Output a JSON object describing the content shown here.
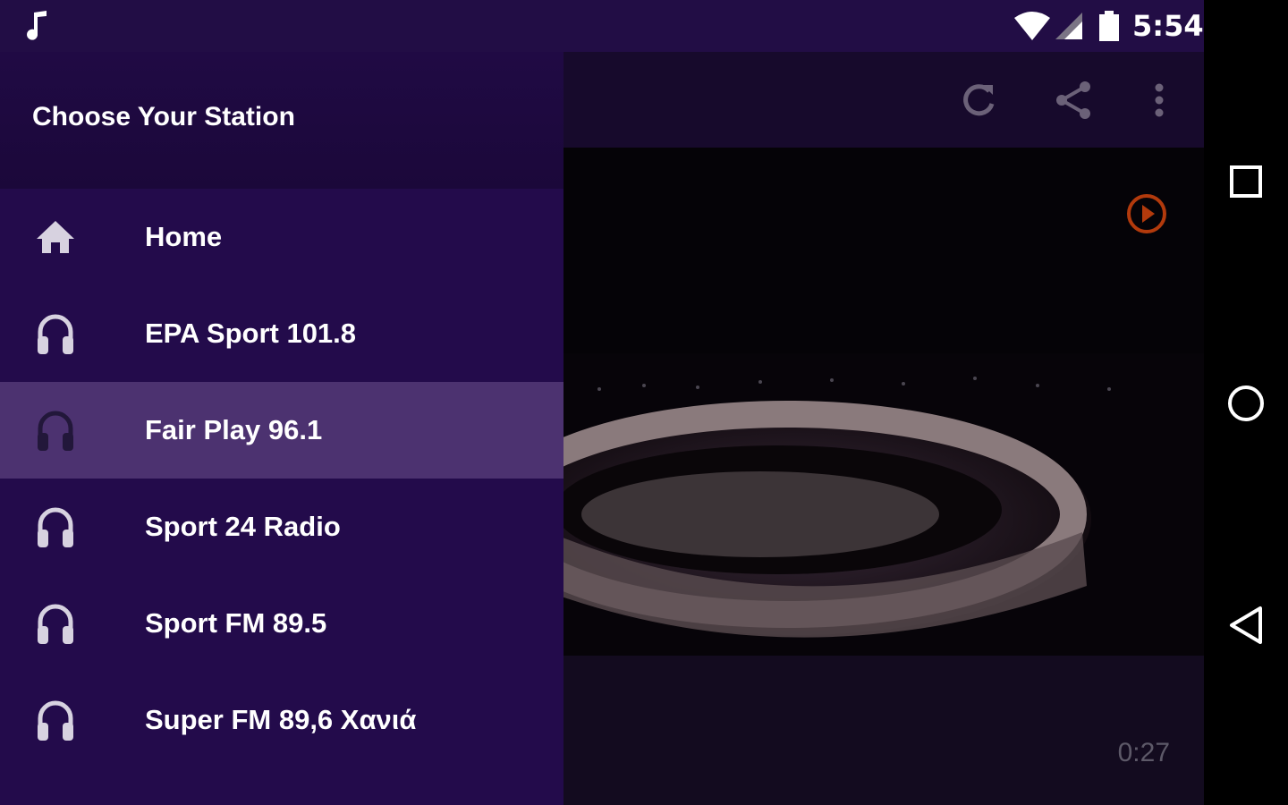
{
  "status_bar": {
    "time": "5:54",
    "icons": [
      "music-note-icon",
      "wifi-icon",
      "signal-icon",
      "battery-icon"
    ]
  },
  "toolbar": {
    "actions": [
      "refresh-icon",
      "share-icon",
      "more-vertical-icon"
    ]
  },
  "drawer": {
    "title": "Choose Your Station",
    "items": [
      {
        "label": "Home",
        "icon": "home-icon",
        "selected": false
      },
      {
        "label": "EPA Sport 101.8",
        "icon": "headphones-icon",
        "selected": false
      },
      {
        "label": "Fair Play 96.1",
        "icon": "headphones-icon",
        "selected": true
      },
      {
        "label": "Sport 24 Radio",
        "icon": "headphones-icon",
        "selected": false
      },
      {
        "label": "Sport FM 89.5",
        "icon": "headphones-icon",
        "selected": false
      },
      {
        "label": "Super FM 89,6 Χανιά",
        "icon": "headphones-icon",
        "selected": false
      }
    ]
  },
  "player": {
    "elapsed": "0:27"
  },
  "navbar": {
    "buttons": [
      "recents-icon",
      "home-circle-icon",
      "back-icon"
    ]
  },
  "colors": {
    "drawer_bg": "#230b4b",
    "selected_bg": "#4c3270",
    "accent_play": "#b23a0c"
  }
}
